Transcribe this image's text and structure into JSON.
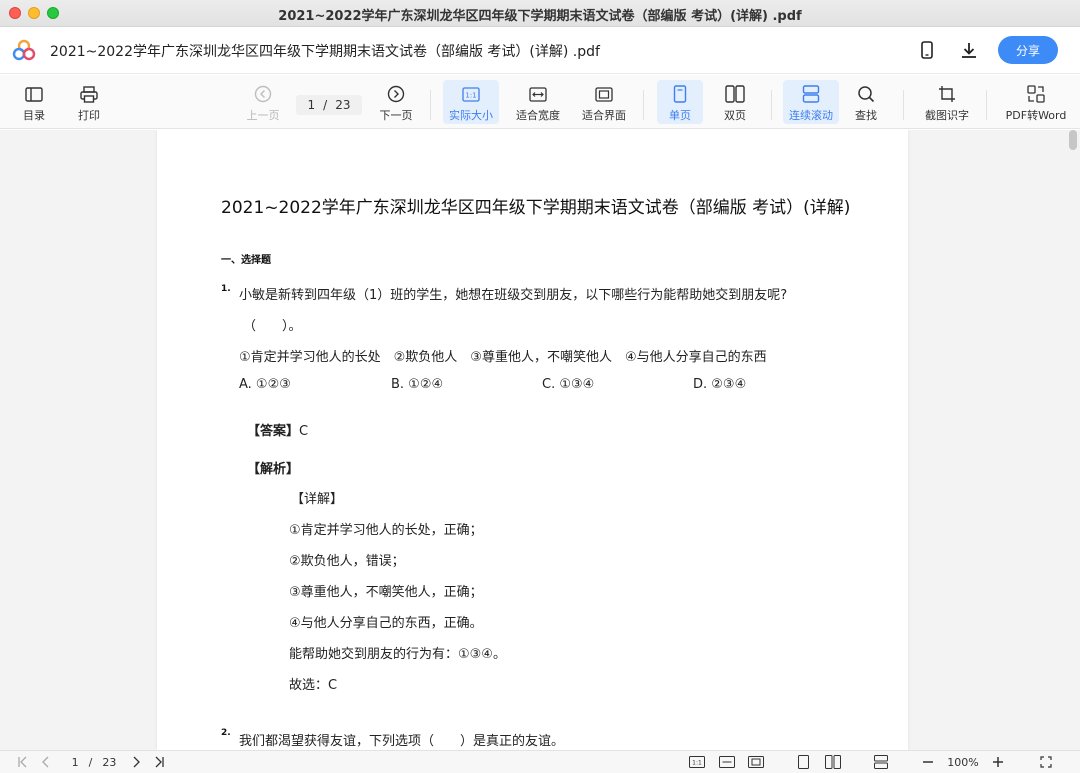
{
  "window": {
    "title": "2021~2022学年广东深圳龙华区四年级下学期期末语文试卷（部编版 考试）(详解) .pdf"
  },
  "header": {
    "doc_title": "2021~2022学年广东深圳龙华区四年级下学期期末语文试卷（部编版 考试）(详解) .pdf",
    "share_label": "分享",
    "icons": [
      "phone-icon",
      "download-icon"
    ]
  },
  "toolbar": {
    "toc": "目录",
    "print": "打印",
    "prev": "上一页",
    "page_current": "1",
    "page_sep": "/",
    "page_total": "23",
    "next": "下一页",
    "actual_size": "实际大小",
    "fit_width": "适合宽度",
    "fit_page": "适合界面",
    "single_page": "单页",
    "double_page": "双页",
    "continuous": "连续滚动",
    "search": "查找",
    "ocr": "截图识字",
    "to_word": "PDF转Word",
    "actual_size_icon_text": "1:1"
  },
  "document": {
    "title": "2021~2022学年广东深圳龙华区四年级下学期期末语文试卷（部编版 考试）(详解)",
    "section": "一、选择题",
    "q1": {
      "num": "1.",
      "text": "小敏是新转到四年级（1）班的学生，她想在班级交到朋友，以下哪些行为能帮助她交到朋友呢?",
      "blank": "（　　）。",
      "items": "①肯定并学习他人的长处　②欺负他人　③尊重他人，不嘲笑他人　④与他人分享自己的东西",
      "options": [
        "A. ①②③",
        "B. ①②④",
        "C. ①③④",
        "D. ②③④"
      ],
      "answer_label": "【答案】",
      "answer": "C",
      "analysis_label": "【解析】",
      "detail_label": "【详解】",
      "details": [
        "①肯定并学习他人的长处，正确；",
        "②欺负他人，错误；",
        "③尊重他人，不嘲笑他人，正确；",
        "④与他人分享自己的东西，正确。",
        "能帮助她交到朋友的行为有：①③④。",
        "故选：C"
      ]
    },
    "q2": {
      "num": "2.",
      "text": "我们都渴望获得友谊，下列选项（　　）是真正的友谊。"
    }
  },
  "statusbar": {
    "page_current": "1",
    "page_sep": "/",
    "page_total": "23",
    "zoom": "100%",
    "actual_size_icon_text": "1:1"
  },
  "colors": {
    "accent": "#3d8bf6",
    "active_bg": "#e4effd",
    "active_text": "#3d7ef0"
  }
}
